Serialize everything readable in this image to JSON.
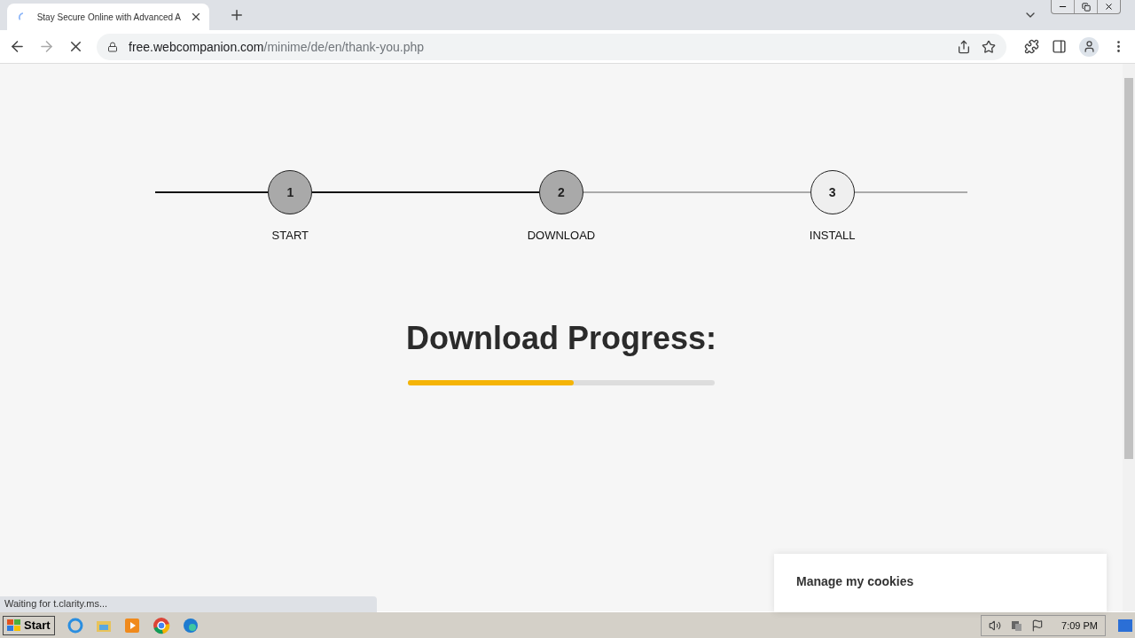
{
  "browser": {
    "tab_title": "Stay Secure Online with Advanced A",
    "url_host": "free.webcompanion.com",
    "url_path": "/minime/de/en/thank-you.php",
    "loading": true
  },
  "steps": [
    {
      "number": "1",
      "label": "START",
      "done": true
    },
    {
      "number": "2",
      "label": "DOWNLOAD",
      "done": true
    },
    {
      "number": "3",
      "label": "INSTALL",
      "done": false
    }
  ],
  "progress": {
    "title": "Download Progress:",
    "level": 0.54
  },
  "cookie_panel": {
    "title": "Manage my cookies"
  },
  "status_bubble": "Waiting for t.clarity.ms...",
  "taskbar": {
    "start": "Start",
    "time": "7:09 PM"
  }
}
